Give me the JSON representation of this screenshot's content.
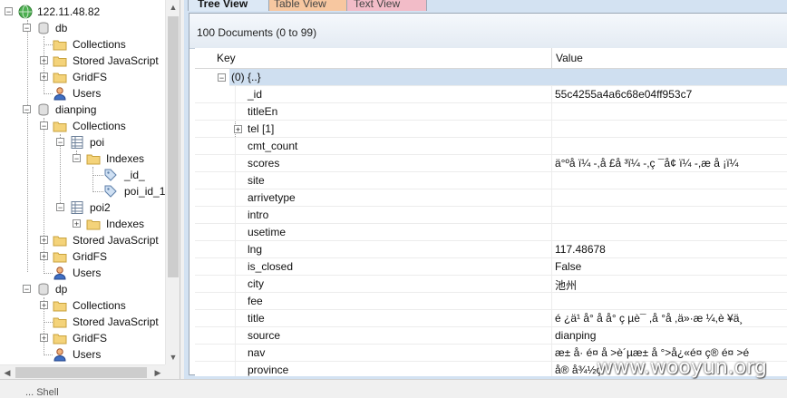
{
  "tree": {
    "server": "122.11.48.82",
    "dbs": [
      {
        "name": "db",
        "items": [
          "Collections",
          "Stored JavaScript",
          "GridFS",
          "Users"
        ]
      },
      {
        "name": "dianping",
        "collections_label": "Collections",
        "poi": "poi",
        "indexes": "Indexes",
        "idx1": "_id_",
        "idx2": "poi_id_1",
        "poi2": "poi2",
        "indexes2": "Indexes",
        "items": [
          "Stored JavaScript",
          "GridFS",
          "Users"
        ]
      },
      {
        "name": "dp",
        "items": [
          "Collections",
          "Stored JavaScript",
          "GridFS",
          "Users"
        ]
      }
    ]
  },
  "tabs": [
    "Tree View",
    "Table View",
    "Text View"
  ],
  "doc_count": "100 Documents (0 to 99)",
  "grid": {
    "col_key": "Key",
    "col_value": "Value",
    "rows": [
      {
        "k": "(0) {..}",
        "v": ""
      },
      {
        "k": "_id",
        "v": "55c4255a4a6c68e04ff953c7"
      },
      {
        "k": "titleEn",
        "v": ""
      },
      {
        "k": "tel [1]",
        "v": ""
      },
      {
        "k": "cmt_count",
        "v": ""
      },
      {
        "k": "scores",
        "v": "ä°ºå   ï¼ -,å £å ³ï¼ -,ç ¯å¢ ï¼ -,æ   å ¡ï¼"
      },
      {
        "k": "site",
        "v": ""
      },
      {
        "k": "arrivetype",
        "v": ""
      },
      {
        "k": "intro",
        "v": ""
      },
      {
        "k": "usetime",
        "v": ""
      },
      {
        "k": "lng",
        "v": "117.48678"
      },
      {
        "k": "is_closed",
        "v": "False"
      },
      {
        "k": "city",
        "v": "池州"
      },
      {
        "k": "fee",
        "v": ""
      },
      {
        "k": "title",
        "v": "é ¿ä¹  å° å   å° ç µè¯ ,å °å   ,ä»·æ ¼,è ¥ä¸"
      },
      {
        "k": "source",
        "v": "dianping"
      },
      {
        "k": "nav",
        "v": "æ± å· é¤ å    >è´µæ± å °>å¿«é¤ ç® é¤ >é"
      },
      {
        "k": "province",
        "v": "å®  å¾½ç"
      }
    ]
  },
  "status": "... Shell",
  "watermark": "www.wooyun.org"
}
